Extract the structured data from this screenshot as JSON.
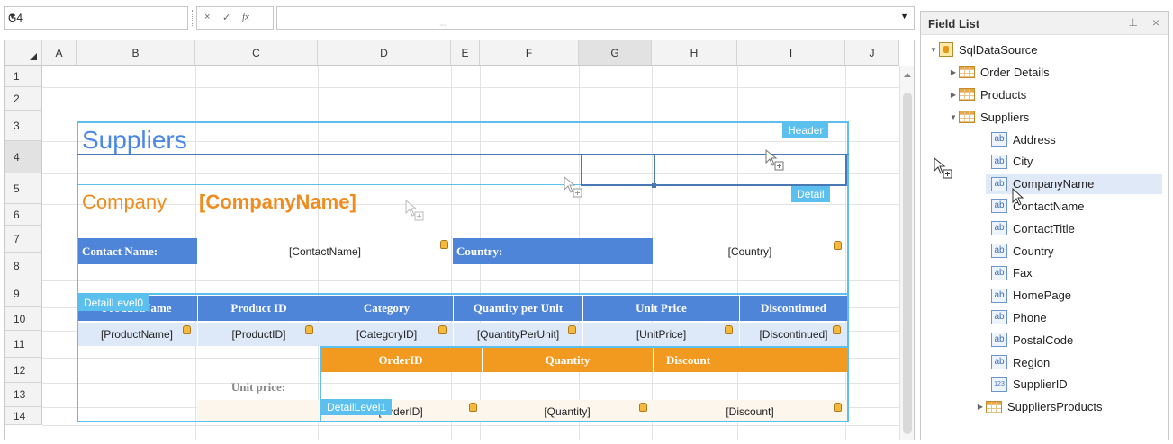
{
  "formula_bar": {
    "name_box": "G4",
    "cancel_glyph": "×",
    "enter_glyph": "✓",
    "fx_glyph": "fx",
    "value": ""
  },
  "grid": {
    "columns": [
      "A",
      "B",
      "C",
      "D",
      "E",
      "F",
      "G",
      "H",
      "I",
      "J"
    ],
    "rows": [
      "1",
      "2",
      "3",
      "4",
      "5",
      "6",
      "7",
      "8",
      "9",
      "10",
      "11",
      "12",
      "13",
      "14"
    ],
    "selected_cell": "G4"
  },
  "report": {
    "title": "Suppliers",
    "company_label": "Company",
    "company_field": "[CompanyName]",
    "contact_label": "Contact Name:",
    "contact_field": "[ContactName]",
    "country_label": "Country:",
    "country_field": "[Country]",
    "product_headers": [
      "ProductName",
      "Product ID",
      "Category",
      "Quantity per Unit",
      "Unit Price",
      "Discontinued"
    ],
    "product_fields": [
      "[ProductName]",
      "[ProductID]",
      "[CategoryID]",
      "[QuantityPerUnit]",
      "[UnitPrice]",
      "[Discontinued]"
    ],
    "order_headers": [
      "OrderID",
      "Quantity",
      "Discount"
    ],
    "unit_price_label": "Unit price:",
    "order_fields": [
      "[OrderID]",
      "[Quantity]",
      "[Discount]"
    ],
    "band_tags": {
      "header": "Header",
      "detail": "Detail",
      "detail_level0": "DetailLevel0",
      "detail_level1": "DetailLevel1"
    }
  },
  "field_list": {
    "title": "Field List",
    "pin_glyph": "⊥",
    "close_glyph": "×",
    "datasource": "SqlDataSource",
    "tables": [
      {
        "label": "Order Details",
        "expanded": false
      },
      {
        "label": "Products",
        "expanded": false
      },
      {
        "label": "Suppliers",
        "expanded": true
      }
    ],
    "supplier_fields": [
      {
        "label": "Address",
        "type": "ab"
      },
      {
        "label": "City",
        "type": "ab"
      },
      {
        "label": "CompanyName",
        "type": "ab",
        "highlighted": true
      },
      {
        "label": "ContactName",
        "type": "ab"
      },
      {
        "label": "ContactTitle",
        "type": "ab"
      },
      {
        "label": "Country",
        "type": "ab"
      },
      {
        "label": "Fax",
        "type": "ab"
      },
      {
        "label": "HomePage",
        "type": "ab"
      },
      {
        "label": "Phone",
        "type": "ab"
      },
      {
        "label": "PostalCode",
        "type": "ab"
      },
      {
        "label": "Region",
        "type": "ab"
      },
      {
        "label": "SupplierID",
        "type": "123"
      }
    ],
    "relation": "SuppliersProducts",
    "icon_labels": {
      "text_field": "ab",
      "number_field": "123"
    }
  }
}
